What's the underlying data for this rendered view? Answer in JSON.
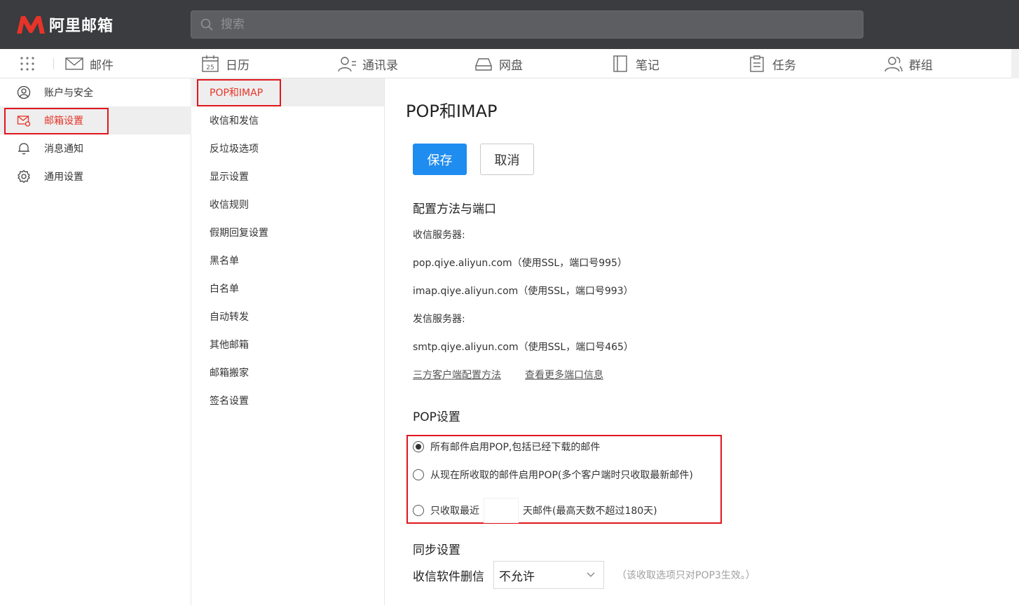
{
  "app": {
    "logo_text": "阿里邮箱",
    "brand_color": "#e6342a",
    "accent_color": "#1f8cf0"
  },
  "search": {
    "placeholder": "搜索",
    "icon": "search-icon"
  },
  "app_nav": {
    "items": [
      {
        "label": "邮件",
        "icon": "mail-icon"
      },
      {
        "label": "日历",
        "icon": "calendar-icon",
        "badge": "25"
      },
      {
        "label": "通讯录",
        "icon": "contacts-icon"
      },
      {
        "label": "网盘",
        "icon": "drive-icon"
      },
      {
        "label": "笔记",
        "icon": "notes-icon"
      },
      {
        "label": "任务",
        "icon": "tasks-icon"
      },
      {
        "label": "群组",
        "icon": "groups-icon"
      }
    ]
  },
  "sidebar": {
    "items": [
      {
        "label": "账户与安全",
        "icon": "user-circle-icon"
      },
      {
        "label": "邮箱设置",
        "icon": "mail-settings-icon",
        "active": true
      },
      {
        "label": "消息通知",
        "icon": "bell-icon"
      },
      {
        "label": "通用设置",
        "icon": "gear-icon"
      }
    ]
  },
  "subnav": {
    "items": [
      {
        "label": "POP和IMAP",
        "active": true
      },
      {
        "label": "收信和发信"
      },
      {
        "label": "反垃圾选项"
      },
      {
        "label": "显示设置"
      },
      {
        "label": "收信规则"
      },
      {
        "label": "假期回复设置"
      },
      {
        "label": "黑名单"
      },
      {
        "label": "白名单"
      },
      {
        "label": "自动转发"
      },
      {
        "label": "其他邮箱"
      },
      {
        "label": "邮箱搬家"
      },
      {
        "label": "签名设置"
      }
    ]
  },
  "main": {
    "title": "POP和IMAP",
    "save_label": "保存",
    "cancel_label": "取消",
    "config": {
      "title": "配置方法与端口",
      "incoming_label": "收信服务器:",
      "pop_line": "pop.qiye.aliyun.com（使用SSL，端口号995）",
      "imap_line": "imap.qiye.aliyun.com（使用SSL，端口号993）",
      "outgoing_label": "发信服务器:",
      "smtp_line": "smtp.qiye.aliyun.com（使用SSL，端口号465）",
      "link_client": "三方客户端配置方法",
      "link_ports": "查看更多端口信息"
    },
    "pop": {
      "title": "POP设置",
      "option_all": "所有邮件启用POP,包括已经下载的邮件",
      "option_from_now": "从现在所收取的邮件启用POP(多个客户端时只收取最新邮件)",
      "option_recent_prefix": "只收取最近",
      "option_recent_suffix": "天邮件(最高天数不超过180天)",
      "recent_days_value": "",
      "selected": "option_all"
    },
    "sync": {
      "title": "同步设置",
      "delete_label": "收信软件删信",
      "delete_value": "不允许",
      "hint": "（该收取选项只对POP3生效。）"
    }
  }
}
